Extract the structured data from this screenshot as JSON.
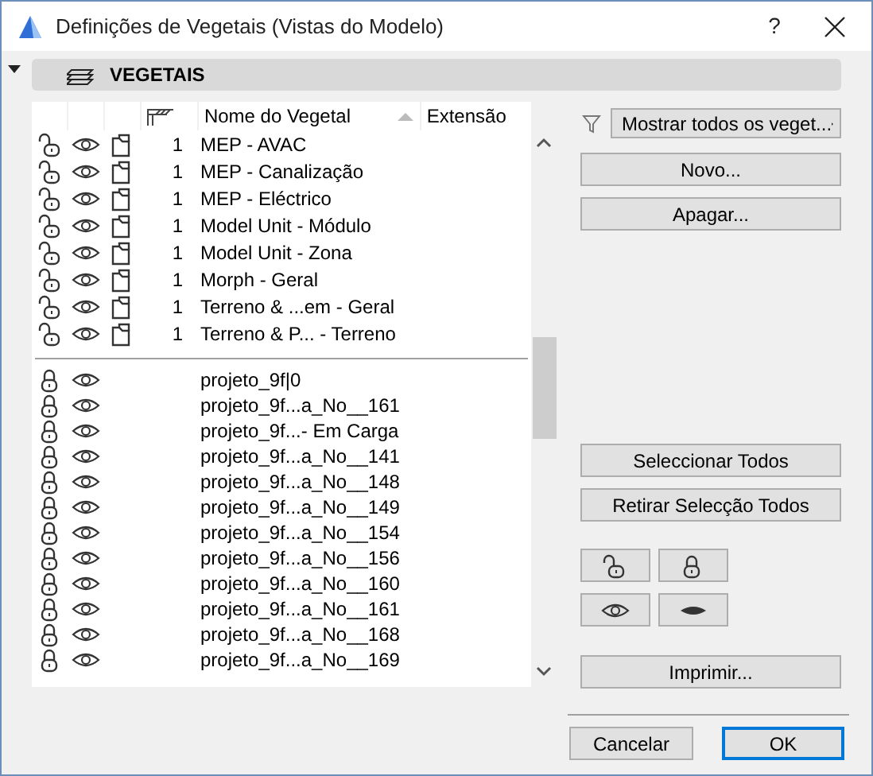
{
  "window": {
    "title": "Definições de Vegetais (Vistas do Modelo)",
    "help": "?"
  },
  "section": {
    "title": "VEGETAIS"
  },
  "table": {
    "columns": [
      "Nome do Vegetal",
      "Extensão"
    ],
    "layer_rows": [
      {
        "locked": false,
        "visible": true,
        "count": "1",
        "name": "MEP - AVAC"
      },
      {
        "locked": false,
        "visible": true,
        "count": "1",
        "name": "MEP - Canalização"
      },
      {
        "locked": false,
        "visible": true,
        "count": "1",
        "name": "MEP - Eléctrico"
      },
      {
        "locked": false,
        "visible": true,
        "count": "1",
        "name": "Model Unit - Módulo"
      },
      {
        "locked": false,
        "visible": true,
        "count": "1",
        "name": "Model Unit - Zona"
      },
      {
        "locked": false,
        "visible": true,
        "count": "1",
        "name": "Morph - Geral"
      },
      {
        "locked": false,
        "visible": true,
        "count": "1",
        "name": "Terreno & ...em - Geral"
      },
      {
        "locked": false,
        "visible": true,
        "count": "1",
        "name": "Terreno & P... - Terreno"
      }
    ],
    "element_rows": [
      {
        "locked": true,
        "visible": true,
        "name": "projeto_9f|0"
      },
      {
        "locked": true,
        "visible": true,
        "name": "projeto_9f...a_No__161"
      },
      {
        "locked": true,
        "visible": true,
        "name": "projeto_9f...- Em Carga"
      },
      {
        "locked": true,
        "visible": true,
        "name": "projeto_9f...a_No__141"
      },
      {
        "locked": true,
        "visible": true,
        "name": "projeto_9f...a_No__148"
      },
      {
        "locked": true,
        "visible": true,
        "name": "projeto_9f...a_No__149"
      },
      {
        "locked": true,
        "visible": true,
        "name": "projeto_9f...a_No__154"
      },
      {
        "locked": true,
        "visible": true,
        "name": "projeto_9f...a_No__156"
      },
      {
        "locked": true,
        "visible": true,
        "name": "projeto_9f...a_No__160"
      },
      {
        "locked": true,
        "visible": true,
        "name": "projeto_9f...a_No__161"
      },
      {
        "locked": true,
        "visible": true,
        "name": "projeto_9f...a_No__168"
      },
      {
        "locked": true,
        "visible": true,
        "name": "projeto_9f...a_No__169"
      }
    ]
  },
  "filter": {
    "value": "Mostrar todos os veget..."
  },
  "actions": [
    "Novo...",
    "Apagar..."
  ],
  "selection_buttons": [
    "Seleccionar Todos",
    "Retirar Selecção Todos"
  ],
  "print_button": "Imprimir...",
  "footer": {
    "cancel": "Cancelar",
    "ok": "OK"
  }
}
